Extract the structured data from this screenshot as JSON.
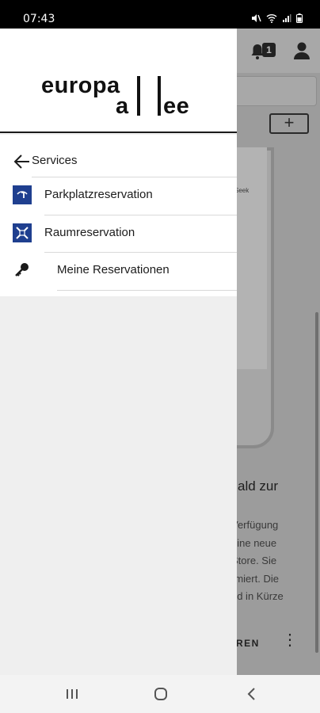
{
  "status_bar": {
    "time": "07:43"
  },
  "background_app": {
    "notification_count": "1",
    "plus_label": "+",
    "phone_caption": "Seek",
    "heading": "ald zur",
    "body_lines": [
      "Verfügung",
      "eine neue",
      "Store. Sie",
      "rmiert. Die",
      "ird in Kürze"
    ],
    "action_label": "REN",
    "more_label": "⋮"
  },
  "drawer": {
    "logo": {
      "line1": "europa",
      "line2_a": "a",
      "line2_b": "ee"
    },
    "back_label": "Services",
    "items": [
      {
        "label": "Parkplatzreservation",
        "icon": "parking-icon"
      },
      {
        "label": "Raumreservation",
        "icon": "room-icon"
      },
      {
        "label": "Meine Reservationen",
        "icon": "key-icon"
      }
    ]
  },
  "nav_bar": {
    "buttons": [
      "recent-apps",
      "home",
      "back"
    ]
  },
  "colors": {
    "drawer_icon_bg": "#1f3f8f",
    "scrim": "#9c9c9c"
  }
}
